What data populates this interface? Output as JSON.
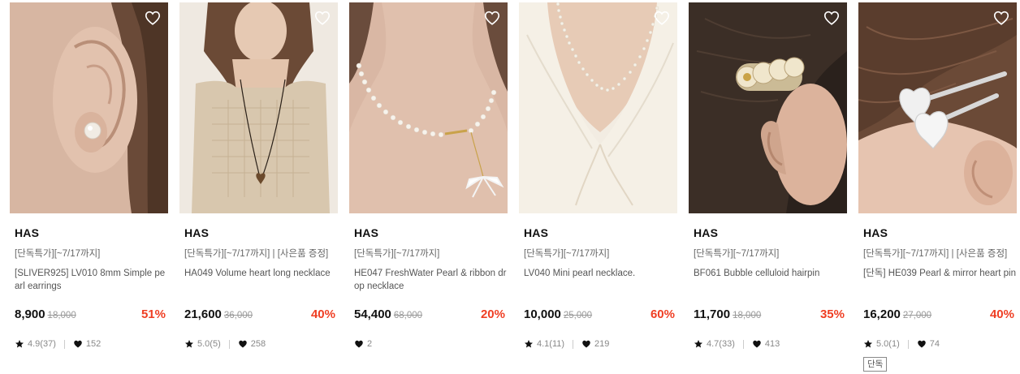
{
  "products": [
    {
      "image_alt": "ear with pearl stud earring",
      "brand": "HAS",
      "promo": "[단독특가][~7/17까지]",
      "name": "[SLIVER925] LV010 8mm Simple pearl earrings",
      "price": "8,900",
      "original_price": "18,000",
      "discount": "51%",
      "rating": "4.9(37)",
      "likes": "152",
      "badge": ""
    },
    {
      "image_alt": "woman wearing knit top with heart pendant necklace",
      "brand": "HAS",
      "promo": "[단독특가][~7/17까지] | [사은품 증정]",
      "name": "HA049 Volume heart long necklace",
      "price": "21,600",
      "original_price": "36,000",
      "discount": "40%",
      "rating": "5.0(5)",
      "likes": "258",
      "badge": ""
    },
    {
      "image_alt": "pearl necklace with ribbon drop",
      "brand": "HAS",
      "promo": "[단독특가][~7/17까지]",
      "name": "HE047 FreshWater Pearl & ribbon drop necklace",
      "price": "54,400",
      "original_price": "68,000",
      "discount": "20%",
      "rating": "",
      "likes": "2",
      "badge": ""
    },
    {
      "image_alt": "mini pearl necklace on white blouse",
      "brand": "HAS",
      "promo": "[단독특가][~7/17까지]",
      "name": "LV040 Mini pearl necklace.",
      "price": "10,000",
      "original_price": "25,000",
      "discount": "60%",
      "rating": "4.1(11)",
      "likes": "219",
      "badge": ""
    },
    {
      "image_alt": "bubble celluloid hairpin in dark hair",
      "brand": "HAS",
      "promo": "[단독특가][~7/17까지]",
      "name": "BF061 Bubble celluloid hairpin",
      "price": "11,700",
      "original_price": "18,000",
      "discount": "35%",
      "rating": "4.7(33)",
      "likes": "413",
      "badge": ""
    },
    {
      "image_alt": "pearl and mirror heart hairpins",
      "brand": "HAS",
      "promo": "[단독특가][~7/17까지] | [사은품 증정]",
      "name": "[단독] HE039 Pearl & mirror heart pin",
      "price": "16,200",
      "original_price": "27,000",
      "discount": "40%",
      "rating": "5.0(1)",
      "likes": "74",
      "badge": "단독"
    }
  ],
  "icons": {
    "wishlist": "heart-outline-icon",
    "rating": "star-icon",
    "likes": "heart-filled-icon"
  },
  "colors": {
    "discount": "#ef3e23",
    "price": "#111111",
    "muted": "#888888"
  }
}
